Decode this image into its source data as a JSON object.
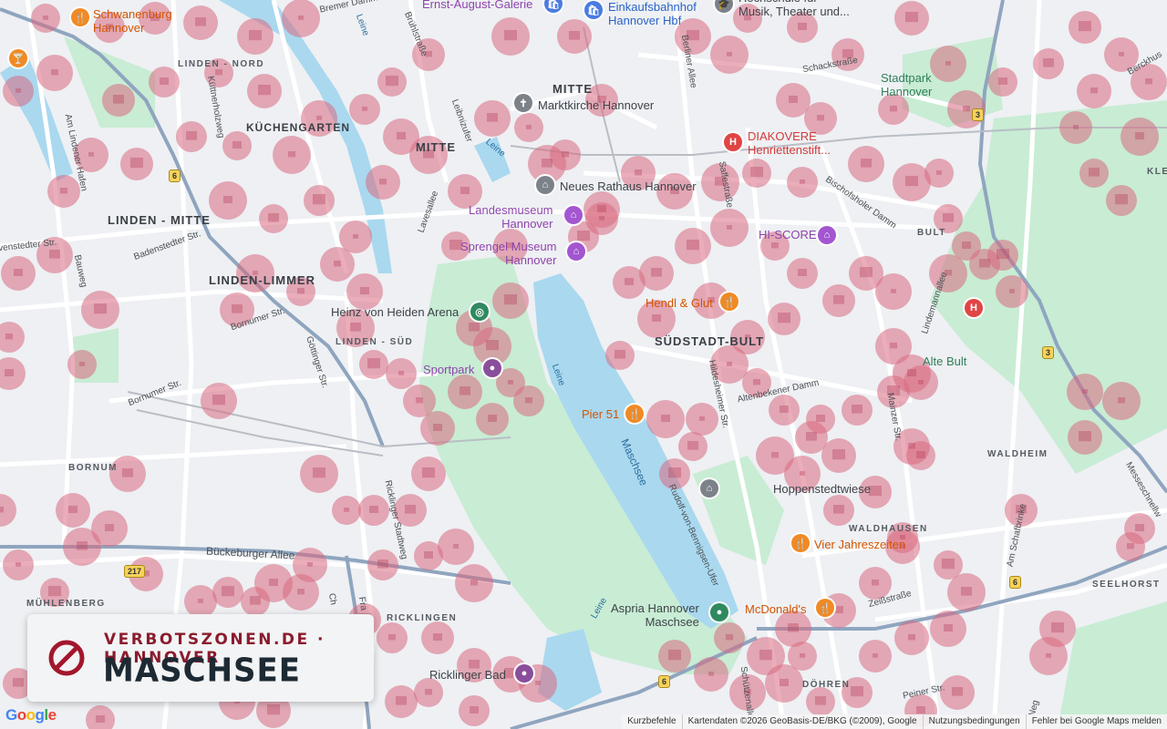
{
  "banner": {
    "kicker": "VERBOTSZONEN.DE · HANNOVER",
    "title": "MASCHSEE",
    "icon": "prohibited-sign-icon"
  },
  "districts": {
    "linden_nord": "LINDEN - NORD",
    "kuechengarten": "KÜCHENGARTEN",
    "linden_mitte": "LINDEN - MITTE",
    "linden_limmer": "LINDEN-LIMMER",
    "linden_sued": "LINDEN - SÜD",
    "mitte_top": "MITTE",
    "mitte": "MITTE",
    "suedstadt_bult": "SÜDSTADT-BULT",
    "bult": "BULT",
    "waldheim": "WALDHEIM",
    "waldhausen": "WALDHAUSEN",
    "seelhorst": "SEELHORST",
    "doehren": "DÖHREN",
    "ricklingen": "RICKLINGEN",
    "muehlenberg": "MÜHLENBERG",
    "bornum": "BORNUM",
    "klei": "KLEI"
  },
  "pois": {
    "schwanenburg": "Schwanenburg\nHannover",
    "ernst_august": "Ernst-August-Galerie",
    "einkaufsbahnhof": "Einkaufsbahnhof\nHannover Hbf",
    "hochschule": "Hochschule für\nMusik, Theater und...",
    "marktkirche": "Marktkirche Hannover",
    "neues_rathaus": "Neues Rathaus Hannover",
    "landesmuseum": "Landesmuseum\nHannover",
    "sprengel": "Sprengel Museum\nHannover",
    "diakovere": "DIAKOVERE\nHenriettenstift...",
    "hiscore": "HI-SCORE",
    "hendl": "Hendl & Glut",
    "heinz": "Heinz von Heiden Arena",
    "sportpark": "Sportpark",
    "pier51": "Pier 51",
    "hoppenstedtwiese": "Hoppenstedtwiese",
    "vier_jahreszeiten": "Vier Jahreszeiten",
    "aspria": "Aspria Hannover\nMaschsee",
    "mcdonalds": "McDonald's",
    "ricklinger_bad": "Ricklinger Bad",
    "stadtpark": "Stadtpark\nHannover",
    "alte_bult": "Alte Bult"
  },
  "streets": {
    "bremer_damm": "Bremer Damm",
    "bruehl": "Brühlstraße",
    "leibniz": "Leibnizufer",
    "berliner": "Berliner Allee",
    "schack": "Schackstraße",
    "berckhus": "Berckhus",
    "kuettner": "Küttnerholzweg",
    "am_lindener_hafen": "Am Lindener Hafen",
    "wunstorfer": "venstedter Str.",
    "bauweg": "Bauweg",
    "badenstedter": "Badenstedter Str.",
    "lavesallee": "Lavesallee",
    "bornumer1": "Bornumer Str.",
    "bornumer2": "Bornumer Str.",
    "goettinger": "Göttinger Str.",
    "ricklinger_stadtweg": "Ricklinger Stadtweg",
    "bueckeburger": "Bückeburger Allee",
    "bischofsholer": "Bischofsholer Damm",
    "saffe": "Saffestraße",
    "hildesheimer": "Hildesheimer Str.",
    "altenbekener": "Altenbekener Damm",
    "lindemann": "Lindemannallee",
    "mainzer": "Mainzer Str.",
    "am_schafbrinke": "Am Schafbrinke",
    "zeiss": "Zeißstraße",
    "peiner": "Peiner Str.",
    "schuetzenallee": "Schützenallee",
    "rudolf": "Rudolf-von-Bennigsen-Ufer",
    "messeschnellweg": "Messeschnellw",
    "leine1": "Leine",
    "leine2": "Leine",
    "leine3": "Leine",
    "leine4": "Leine",
    "franz": "Fra",
    "neg": "Neg",
    "ch": "Ch"
  },
  "water": {
    "maschsee": "Maschsee"
  },
  "road_badges": {
    "b6a": "6",
    "b3a": "3",
    "b3b": "3",
    "b6b": "6",
    "b6c": "6",
    "b217": "217"
  },
  "attribution": {
    "google": "Google",
    "shortcuts": "Kurzbefehle",
    "data": "Kartendaten ©2026 GeoBasis-DE/BKG (©2009), Google",
    "terms": "Nutzungsbedingungen",
    "report": "Fehler bei Google Maps melden"
  },
  "colors": {
    "zone": "#d86a7f",
    "water": "#a9d8ef",
    "park": "#c8ecd4",
    "road": "#ffffff",
    "highway": "#8fa5bf"
  }
}
